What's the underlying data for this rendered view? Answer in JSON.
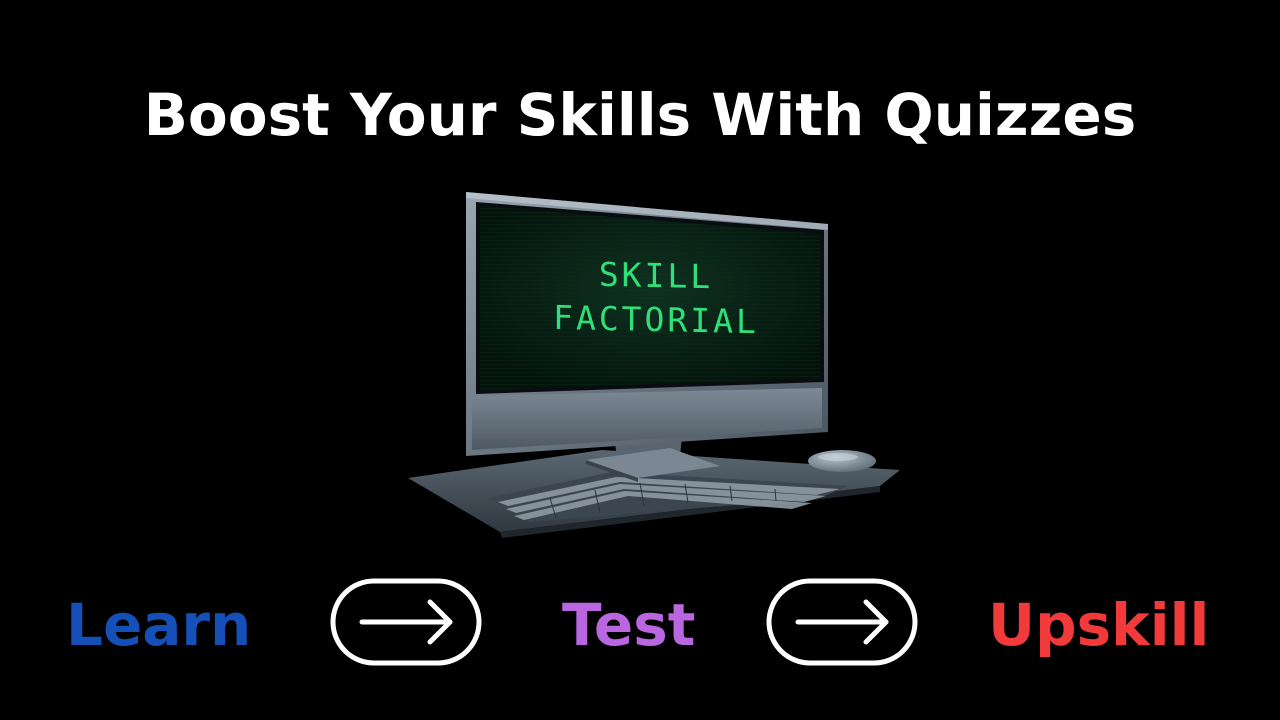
{
  "headline": "Boost Your Skills With Quizzes",
  "screen": {
    "line1": "SKILL",
    "line2": "FACTORIAL",
    "text_color": "#2fe07a"
  },
  "steps": [
    {
      "label": "Learn",
      "color": "#1550b8"
    },
    {
      "label": "Test",
      "color": "#b966e0"
    },
    {
      "label": "Upskill",
      "color": "#f23a3a"
    }
  ],
  "arrows": [
    {
      "icon": "arrow-right-icon"
    },
    {
      "icon": "arrow-right-icon"
    }
  ],
  "colors": {
    "background": "#000000",
    "headline": "#ffffff",
    "arrow_stroke": "#ffffff"
  }
}
